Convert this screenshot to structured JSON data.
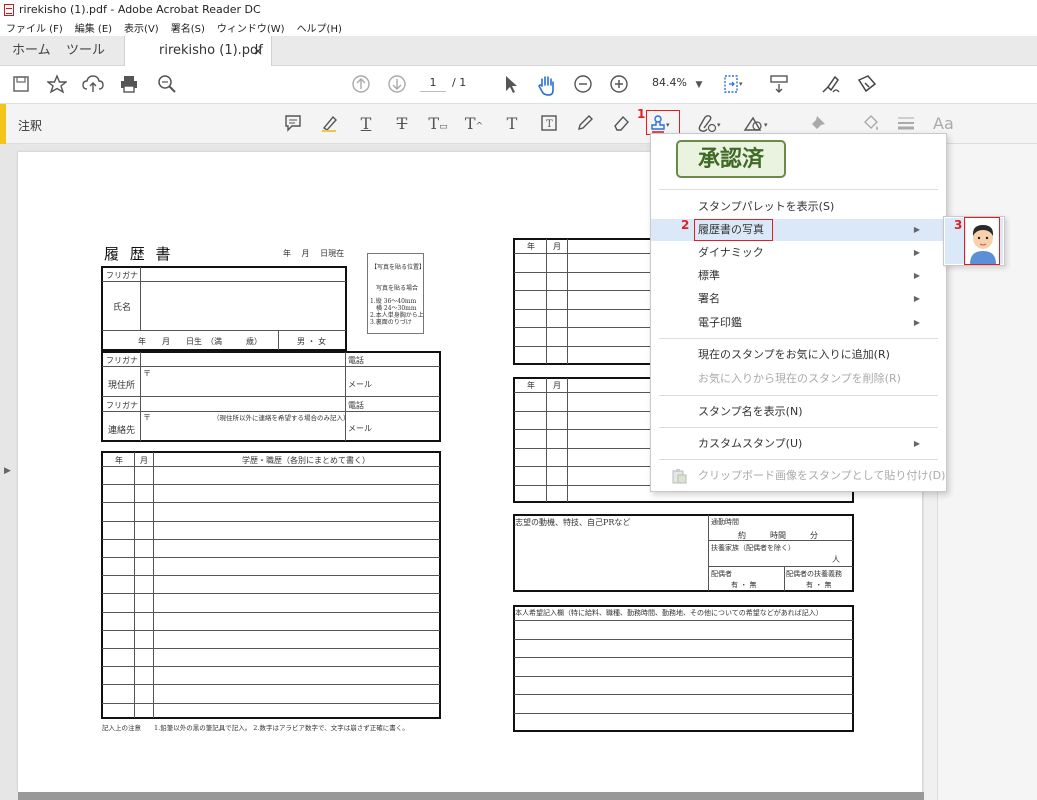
{
  "window": {
    "title": "rirekisho (1).pdf - Adobe Acrobat Reader DC"
  },
  "menubar": [
    "ファイル (F)",
    "編集 (E)",
    "表示(V)",
    "署名(S)",
    "ウィンドウ(W)",
    "ヘルプ(H)"
  ],
  "tabs": {
    "home": "ホーム",
    "tools": "ツール",
    "doc": "rirekisho (1).pdf",
    "close": "×"
  },
  "toolbar": {
    "page_current": "1",
    "page_total": "/ 1",
    "zoom": "84.4%"
  },
  "annot": {
    "label": "注釈"
  },
  "markers": {
    "m1": "1",
    "m2": "2",
    "m3": "3"
  },
  "stamp_menu": {
    "preview": "承認済",
    "items": [
      {
        "label": "スタンプパレットを表示(S)"
      },
      {
        "label": "履歴書の写真"
      },
      {
        "label": "ダイナミック"
      },
      {
        "label": "標準"
      },
      {
        "label": "署名"
      },
      {
        "label": "電子印鑑"
      },
      {
        "label": "現在のスタンプをお気に入りに追加(R)"
      },
      {
        "label": "お気に入りから現在のスタンプを削除(R)"
      },
      {
        "label": "スタンプ名を表示(N)"
      },
      {
        "label": "カスタムスタンプ(U)"
      },
      {
        "label": "クリップボード画像をスタンプとして貼り付け(D)"
      }
    ]
  },
  "resume": {
    "title": "履 歴 書",
    "date": "年　 月　 日現在",
    "photo_title": "【写真を貼る位置】",
    "photo_lines": [
      "写真を貼る場合",
      "1.縦 36～40mm",
      "　横 24～30mm",
      "2.本人単身胸から上",
      "3.裏面のりづけ"
    ],
    "furigana": "フリガナ",
    "name": "氏名",
    "birth": "年　　月　　日生　（満　　　歳）",
    "gender": "男 ・ 女",
    "address": "現住所",
    "contact": "連絡先",
    "phone": "電話",
    "mail": "メール",
    "postal": "〒",
    "contact_note": "（現住所以外に連絡を希望する場合のみ記入）",
    "year": "年",
    "month": "月",
    "history": "学歴・職歴（各別にまとめて書く）",
    "footnote": "記入上の注意　　1.鉛筆以外の黒の筆記具で記入。 2.数字はアラビア数字で、文字は崩さず正確に書く。",
    "motive": "志望の動機、特技、自己PRなど",
    "commute": "通勤時間",
    "commute_val": "約　　　時間　　　分",
    "dependents": "扶養家族（配偶者を除く）",
    "dependents_unit": "人",
    "spouse": "配偶者",
    "spouse_support": "配偶者の扶養義務",
    "yes_no": "有 ・ 無",
    "wishes": "本人希望記入欄（特に給料、職種、勤務時間、勤務地、その他についての希望などがあれば記入）"
  }
}
